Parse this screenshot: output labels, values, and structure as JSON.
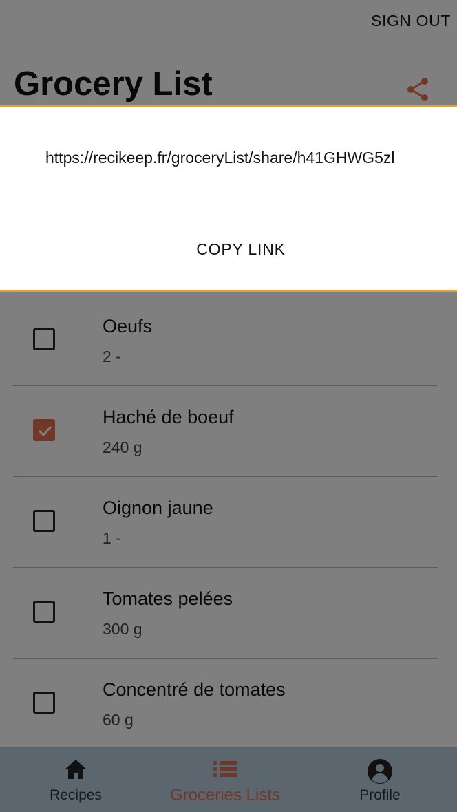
{
  "header": {
    "sign_out_label": "SIGN OUT",
    "title": "Grocery List"
  },
  "share_icon": "share-icon",
  "items": [
    {
      "name": "Oeufs",
      "qty": "2 -",
      "checked": false
    },
    {
      "name": "Haché de boeuf",
      "qty": "240 g",
      "checked": true
    },
    {
      "name": "Oignon jaune",
      "qty": "1 -",
      "checked": false
    },
    {
      "name": "Tomates pelées",
      "qty": "300 g",
      "checked": false
    },
    {
      "name": "Concentré de tomates",
      "qty": "60 g",
      "checked": false
    }
  ],
  "bottom_nav": {
    "items": [
      {
        "label": "Recipes",
        "icon": "home-icon",
        "active": false
      },
      {
        "label": "Groceries Lists",
        "icon": "list-icon",
        "active": true
      },
      {
        "label": "Profile",
        "icon": "account-circle-icon",
        "active": false
      }
    ]
  },
  "dialog": {
    "url": "https://recikeep.fr/groceryList/share/h41GHWG5zl",
    "copy_label": "COPY LINK"
  },
  "colors": {
    "accent": "#e4704f",
    "dialog_border": "#e2a03a",
    "nav_background": "#b9ccdf"
  }
}
